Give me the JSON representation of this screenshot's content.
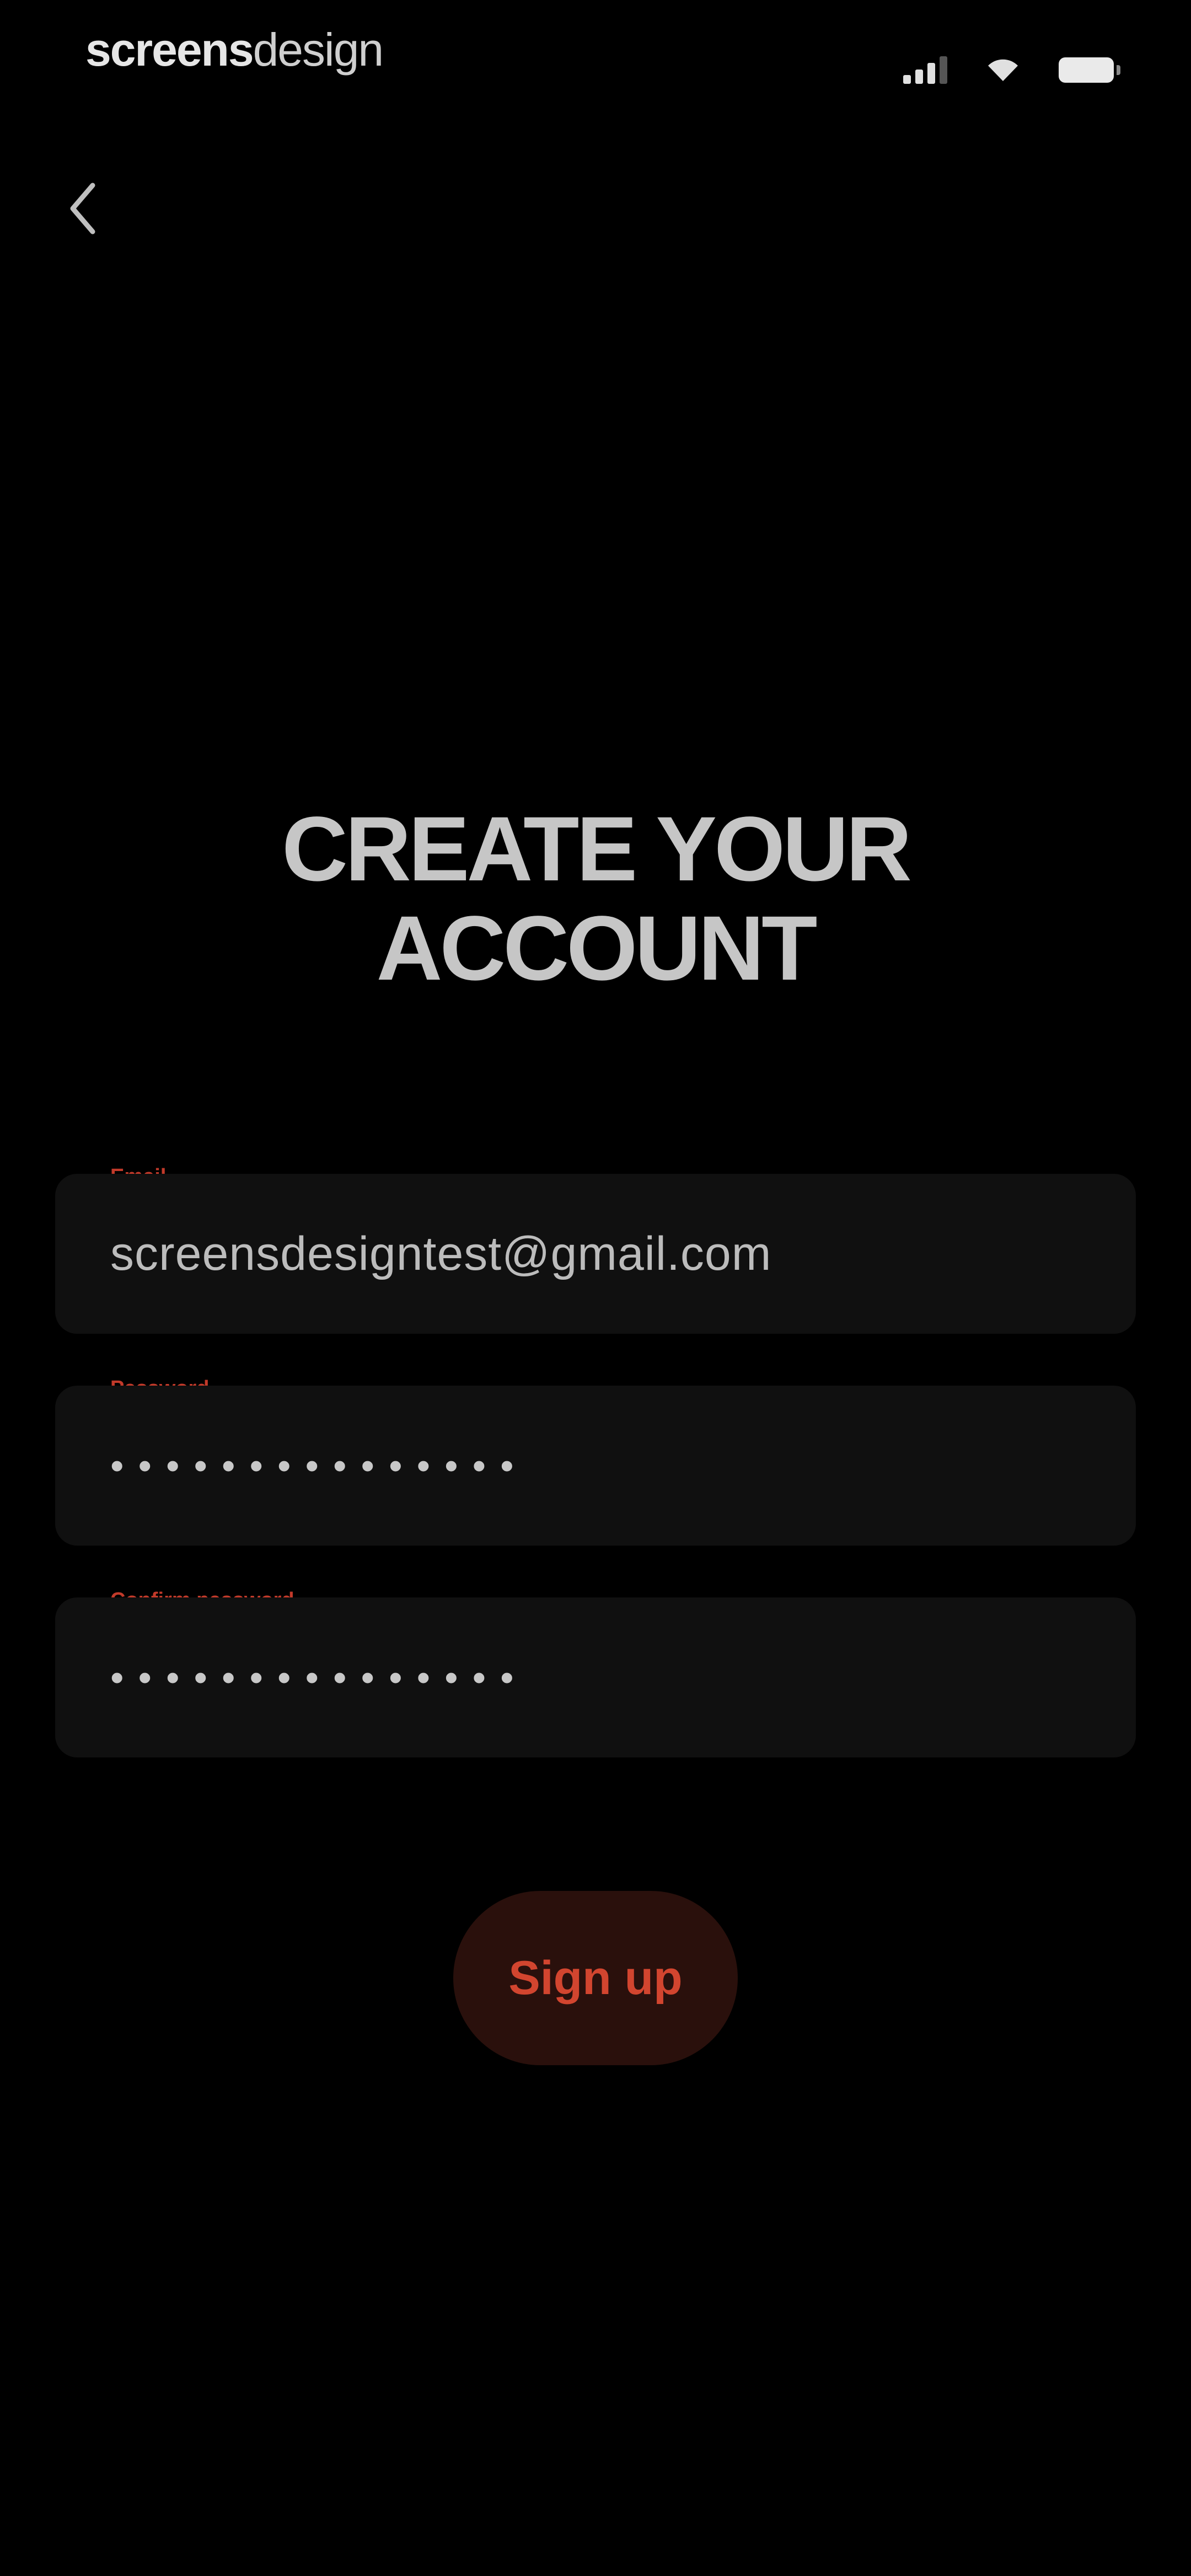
{
  "status_bar": {
    "brand_bold": "screens",
    "brand_light": "design"
  },
  "header": {
    "back_icon": "chevron-left-icon"
  },
  "title": {
    "line1": "CREATE YOUR",
    "line2": "ACCOUNT"
  },
  "form": {
    "email": {
      "label": "Email",
      "value": "screensdesigntest@gmail.com"
    },
    "password": {
      "label": "Password",
      "value": "•••••••••••••••"
    },
    "confirm_password": {
      "label": "Confirm password",
      "value": "•••••••••••••••"
    }
  },
  "signup_button": {
    "label": "Sign up"
  },
  "colors": {
    "background": "#000000",
    "field_bg": "#101010",
    "accent": "#d2452f",
    "button_bg": "#2a100c"
  }
}
